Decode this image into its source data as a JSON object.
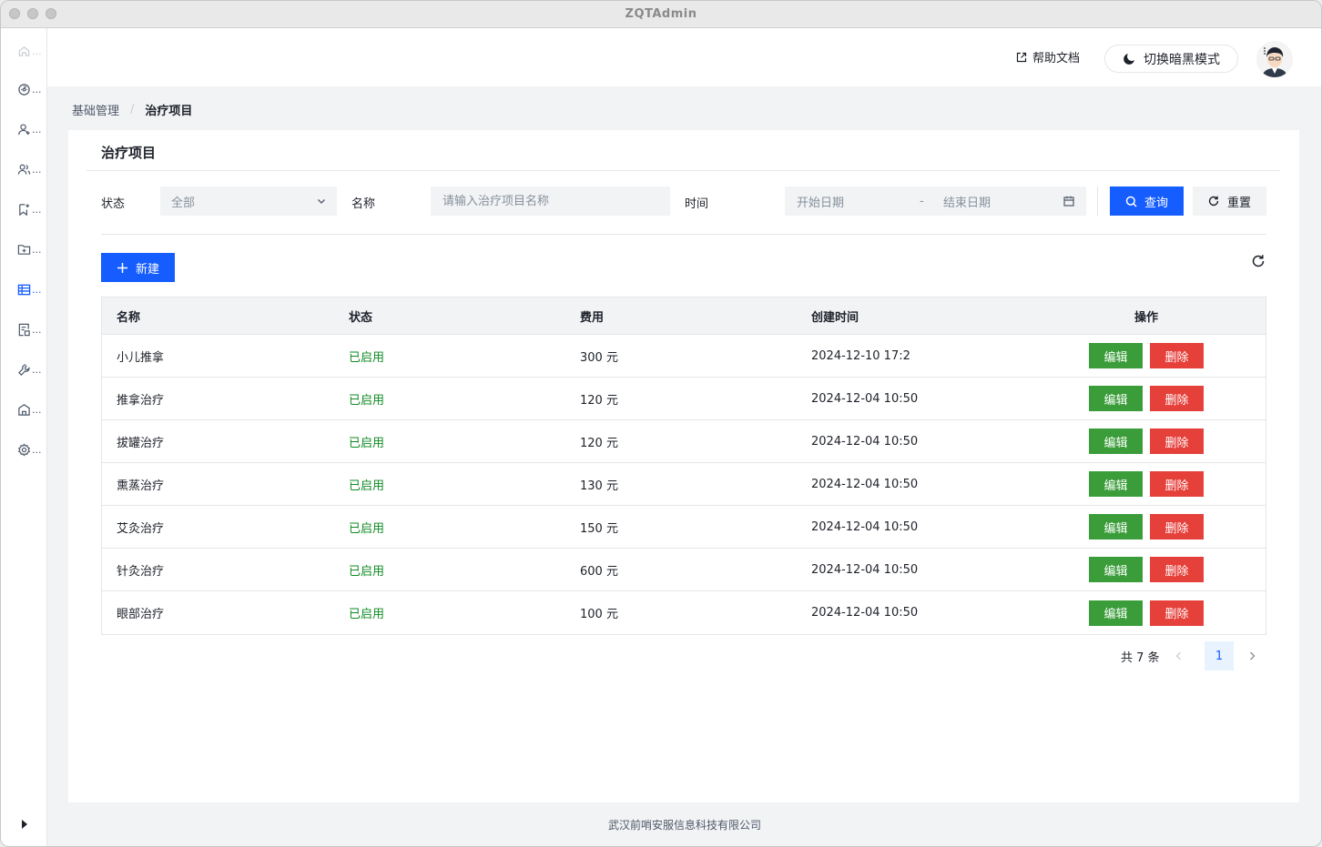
{
  "window": {
    "title": "ZQTAdmin"
  },
  "header": {
    "help_label": "帮助文档",
    "dark_mode_label": "切换暗黑模式"
  },
  "sidebar": {
    "items": [
      {
        "icon": "home-icon",
        "dots": "..."
      },
      {
        "icon": "dashboard-icon",
        "dots": "..."
      },
      {
        "icon": "user-add-icon",
        "dots": "..."
      },
      {
        "icon": "users-icon",
        "dots": "..."
      },
      {
        "icon": "bookmark-add-icon",
        "dots": "..."
      },
      {
        "icon": "folder-add-icon",
        "dots": "..."
      },
      {
        "icon": "table-icon",
        "dots": "...",
        "active": true
      },
      {
        "icon": "form-icon",
        "dots": "..."
      },
      {
        "icon": "tool-icon",
        "dots": "..."
      },
      {
        "icon": "building-icon",
        "dots": "..."
      },
      {
        "icon": "settings-icon",
        "dots": "..."
      }
    ]
  },
  "breadcrumb": {
    "parent": "基础管理",
    "separator": "/",
    "current": "治疗项目"
  },
  "card": {
    "title": "治疗项目"
  },
  "filters": {
    "status_label": "状态",
    "status_value": "全部",
    "name_label": "名称",
    "name_placeholder": "请输入治疗项目名称",
    "time_label": "时间",
    "start_placeholder": "开始日期",
    "range_separator": "-",
    "end_placeholder": "结束日期",
    "query_label": "查询",
    "reset_label": "重置"
  },
  "toolbar": {
    "new_label": "新建"
  },
  "table": {
    "columns": [
      "名称",
      "状态",
      "费用",
      "创建时间",
      "操作"
    ],
    "edit_label": "编辑",
    "delete_label": "删除",
    "rows": [
      {
        "name": "小儿推拿",
        "status": "已启用",
        "fee": "300 元",
        "created": "2024-12-10 17:2"
      },
      {
        "name": "推拿治疗",
        "status": "已启用",
        "fee": "120 元",
        "created": "2024-12-04 10:50"
      },
      {
        "name": "拔罐治疗",
        "status": "已启用",
        "fee": "120 元",
        "created": "2024-12-04 10:50"
      },
      {
        "name": "熏蒸治疗",
        "status": "已启用",
        "fee": "130 元",
        "created": "2024-12-04 10:50"
      },
      {
        "name": "艾灸治疗",
        "status": "已启用",
        "fee": "150 元",
        "created": "2024-12-04 10:50"
      },
      {
        "name": "针灸治疗",
        "status": "已启用",
        "fee": "600 元",
        "created": "2024-12-04 10:50"
      },
      {
        "name": "眼部治疗",
        "status": "已启用",
        "fee": "100 元",
        "created": "2024-12-04 10:50"
      }
    ]
  },
  "pagination": {
    "total_text": "共 7 条",
    "current_page": "1"
  },
  "footer": {
    "company": "武汉前哨安服信息科技有限公司"
  },
  "colors": {
    "primary": "#165dff",
    "success": "#3a9d3a",
    "danger": "#e5403a",
    "enabled_text": "#0e8a22"
  }
}
